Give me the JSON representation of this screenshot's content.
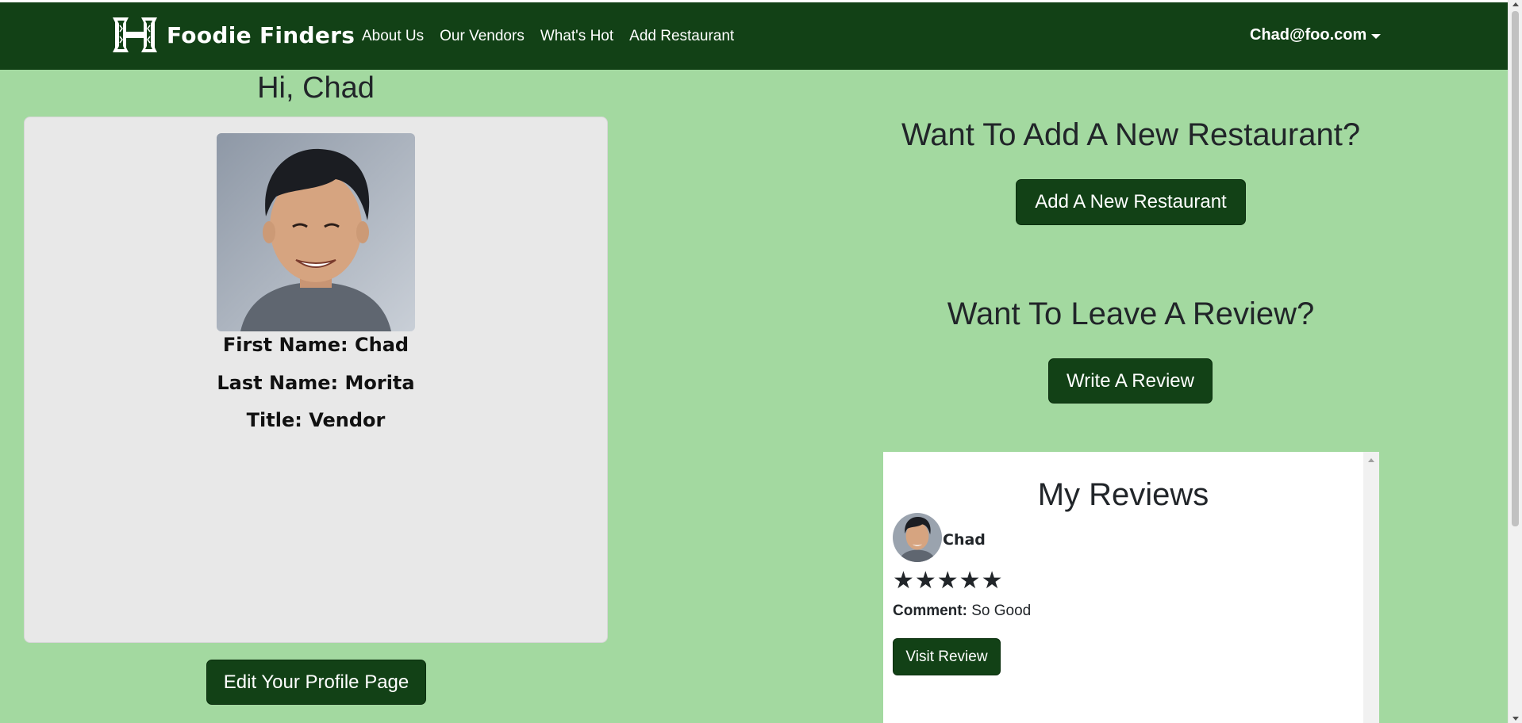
{
  "nav": {
    "brand": "Foodie Finders",
    "links": [
      "About Us",
      "Our Vendors",
      "What's Hot",
      "Add Restaurant"
    ],
    "user": "Chad@foo.com"
  },
  "profile": {
    "greeting": "Hi, Chad",
    "first_name": "First Name: Chad",
    "last_name": "Last Name: Morita",
    "title": "Title: Vendor",
    "edit_button": "Edit Your Profile Page"
  },
  "cta": {
    "add_heading": "Want To Add A New Restaurant?",
    "add_button": "Add A New Restaurant",
    "review_heading": "Want To Leave A Review?",
    "review_button": "Write A Review"
  },
  "reviews": {
    "title": "My Reviews",
    "items": [
      {
        "name": "Chad",
        "stars": "★★★★★",
        "rating": 5,
        "comment_label": "Comment:",
        "comment": "So Good",
        "visit_button": "Visit Review"
      }
    ]
  },
  "colors": {
    "page_bg": "#a3d9a0",
    "nav_bg": "#124116",
    "button_bg": "#124116",
    "card_bg": "#e8e8e8"
  }
}
